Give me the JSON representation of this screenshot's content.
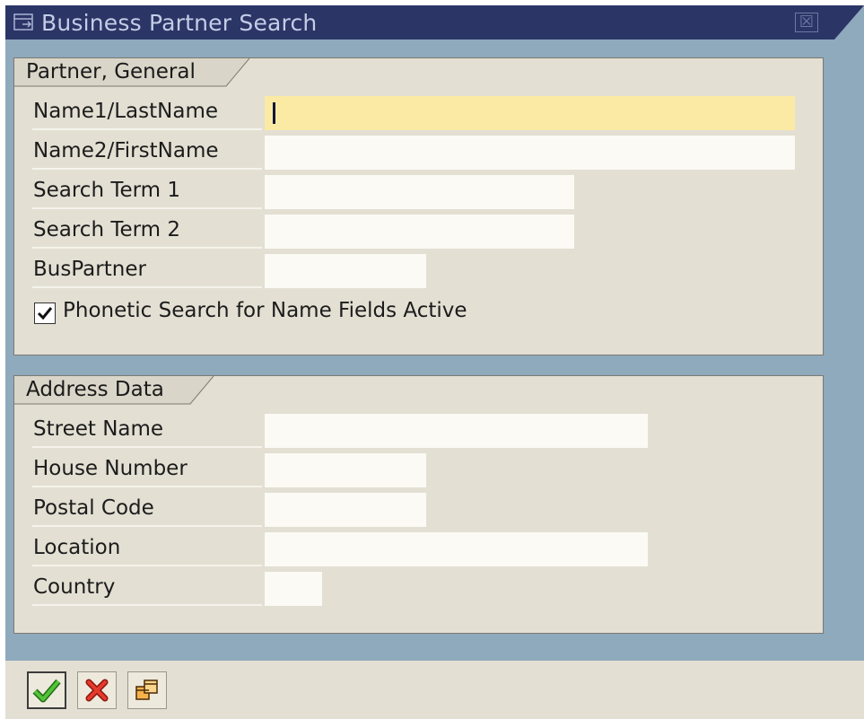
{
  "window": {
    "title": "Business Partner Search",
    "close_symbol": "☒"
  },
  "partner_group": {
    "title": "Partner, General",
    "fields": [
      {
        "label": "Name1/LastName",
        "value": ""
      },
      {
        "label": "Name2/FirstName",
        "value": ""
      },
      {
        "label": "Search Term 1",
        "value": ""
      },
      {
        "label": "Search Term 2",
        "value": ""
      },
      {
        "label": "BusPartner",
        "value": ""
      }
    ],
    "phonetic_checkbox": {
      "label": "Phonetic Search for Name Fields Active",
      "checked": true
    }
  },
  "address_group": {
    "title": "Address Data",
    "fields": [
      {
        "label": "Street Name",
        "value": ""
      },
      {
        "label": "House Number",
        "value": ""
      },
      {
        "label": "Postal Code",
        "value": ""
      },
      {
        "label": "Location",
        "value": ""
      },
      {
        "label": "Country",
        "value": ""
      }
    ]
  },
  "footer": {
    "buttons": [
      {
        "icon": "checkmark-icon",
        "color": "#2f9a1f"
      },
      {
        "icon": "cancel-x-icon",
        "color": "#d8221a"
      },
      {
        "icon": "copy-window-icon",
        "color": "#e08a1a"
      }
    ]
  },
  "colors": {
    "title_bar": "#2b3566",
    "frame": "#8fa9bd",
    "panel": "#e3dfd3",
    "focused_field": "#fbeaa4"
  }
}
